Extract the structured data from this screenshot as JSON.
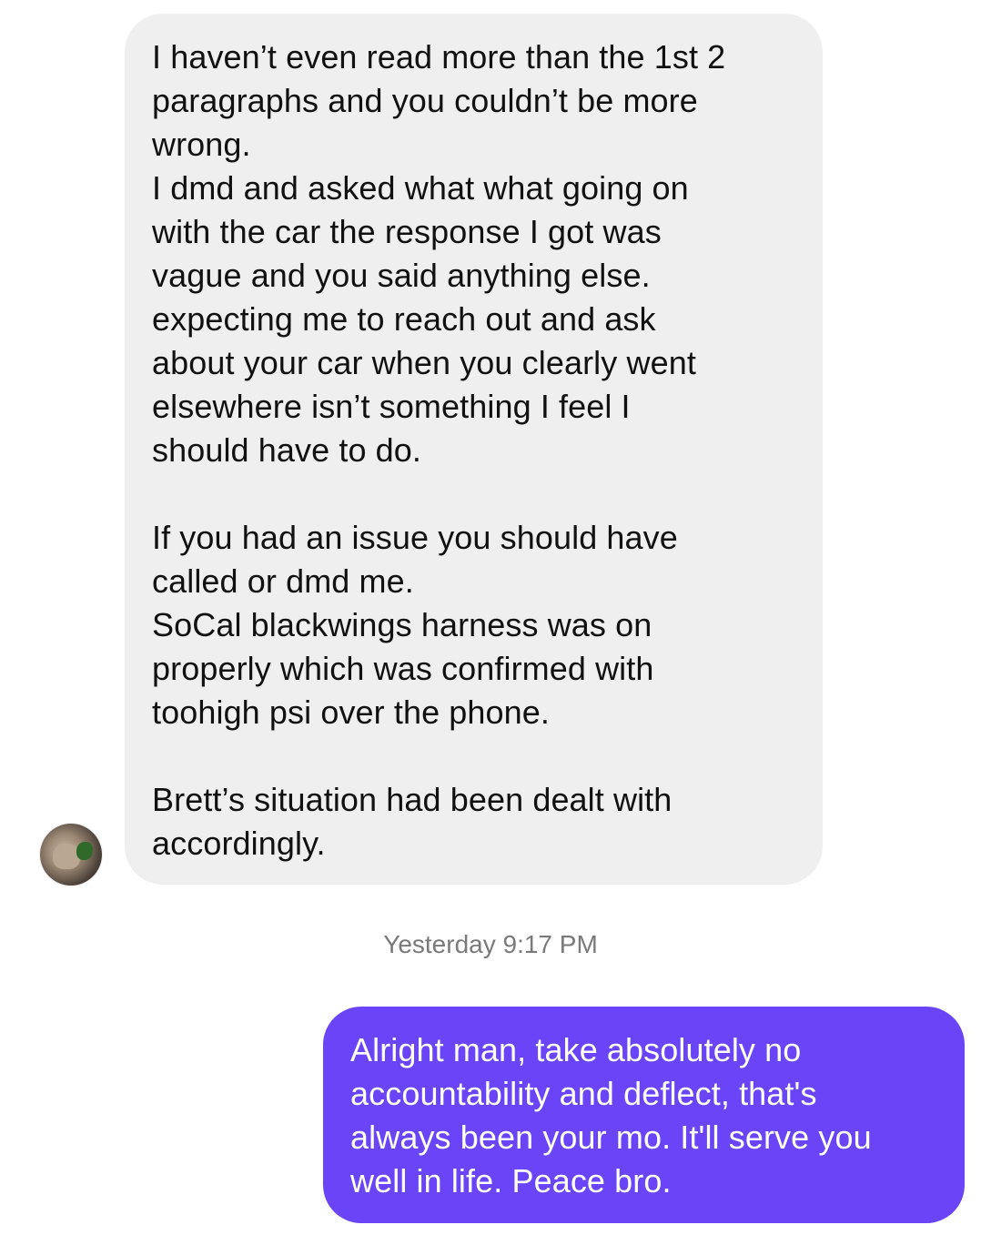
{
  "conversation": {
    "received_message": {
      "text": "I haven’t even read more than the 1st 2\nparagraphs and you couldn’t be more\nwrong.\nI dmd and asked what what going on\nwith the car the response I got was\nvague and you said anything else.\nexpecting me to reach out and ask\nabout your car when you clearly went\nelsewhere isn’t something I feel I\nshould have to do.\n\nIf you had an issue you should have\ncalled or dmd me.\nSoCal blackwings harness was on\nproperly which was confirmed with\ntoohigh psi over the phone.\n\nBrett’s situation had been dealt with\naccordingly.",
      "avatar_icon": "dog-avatar-icon",
      "bubble_color": "#efefef"
    },
    "timestamp": "Yesterday 9:17 PM",
    "sent_message": {
      "text": "Alright man, take absolutely no\naccountability and deflect, that's\nalways been your mo. It'll serve you\nwell in life. Peace bro.",
      "bubble_color": "#6a45f8"
    }
  }
}
